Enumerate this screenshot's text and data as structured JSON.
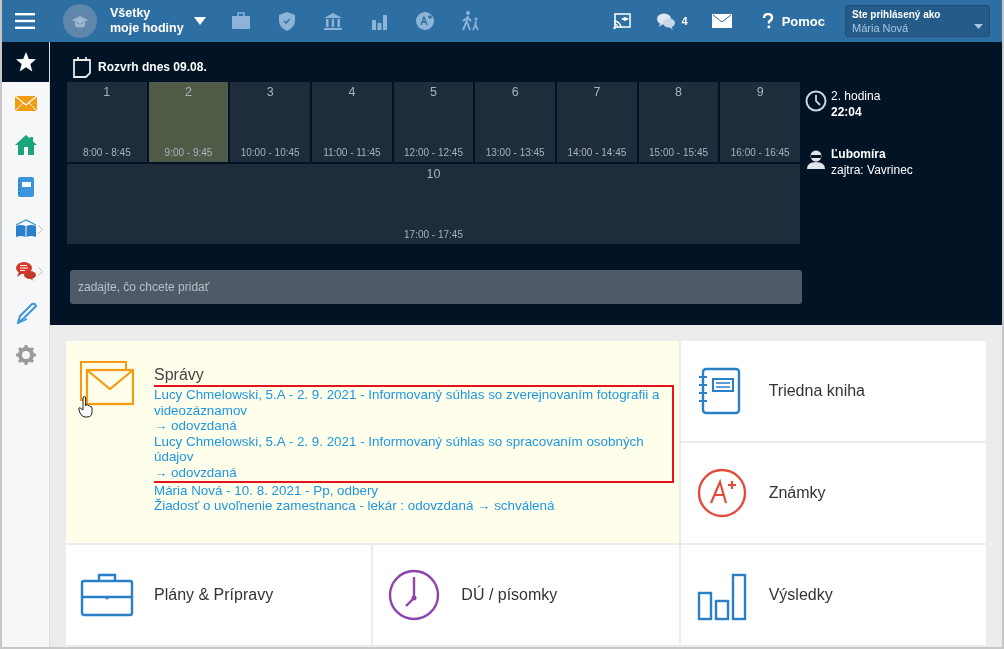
{
  "top_bar": {
    "scope_line1": "Všetky",
    "scope_line2": "moje hodiny",
    "chat_count": "4",
    "help_label": "Pomoc",
    "user_label": "Ste prihlásený ako",
    "user_name": "Mária Nová"
  },
  "schedule": {
    "title": "Rozvrh dnes 09.08.",
    "lessons": [
      {
        "number": "1",
        "time": "8:00 - 8:45",
        "current": false
      },
      {
        "number": "2",
        "time": "9:00 - 9:45",
        "current": true
      },
      {
        "number": "3",
        "time": "10:00 - 10:45",
        "current": false
      },
      {
        "number": "4",
        "time": "11:00 - 11:45",
        "current": false
      },
      {
        "number": "5",
        "time": "12:00 - 12:45",
        "current": false
      },
      {
        "number": "6",
        "time": "13:00 - 13:45",
        "current": false
      },
      {
        "number": "7",
        "time": "14:00 - 14:45",
        "current": false
      },
      {
        "number": "8",
        "time": "15:00 - 15:45",
        "current": false
      },
      {
        "number": "9",
        "time": "16:00 - 16:45",
        "current": false
      },
      {
        "number": "10",
        "time": "17:00 - 17:45",
        "current": false
      }
    ],
    "add_field": {
      "placeholder": "zadajte, čo chcete pridať"
    }
  },
  "info": {
    "lesson": "2. hodina",
    "time": "22:04",
    "name_day": "Ľubomíra",
    "tomorrow": "zajtra: Vavrinec"
  },
  "tiles": [
    {
      "kind": "messages",
      "title": "Správy",
      "messages": [
        {
          "title": "Lucy Chmelowski, 5.A - 2. 9. 2021 - Informovaný súhlas so zverejnovaním fotografii a videozáznamov",
          "status": "→ odovzdaná",
          "highlighted": true
        },
        {
          "title": "Lucy Chmelowski, 5.A - 2. 9. 2021 - Informovaný súhlas so spracovaním osobných údajov",
          "status": "→ odovzdaná",
          "highlighted": true
        },
        {
          "title": "Mária Nová - 10. 8. 2021 - Pp, odbery",
          "status": "Žiadosť o uvoľnenie zamestnanca - lekár : odovzdaná → schválená",
          "highlighted": false
        }
      ]
    },
    {
      "kind": "classbook",
      "title": "Triedna kniha"
    },
    {
      "kind": "grades",
      "title": "Známky"
    },
    {
      "kind": "plans",
      "title": "Plány & Prípravy"
    },
    {
      "kind": "homework",
      "title": "DÚ / písomky"
    },
    {
      "kind": "results",
      "title": "Výsledky"
    }
  ]
}
